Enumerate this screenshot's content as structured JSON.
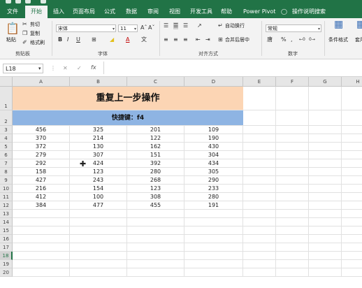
{
  "ribbon_tabs": [
    "文件",
    "开始",
    "插入",
    "页面布局",
    "公式",
    "数据",
    "审阅",
    "视图",
    "开发工具",
    "帮助",
    "Power Pivot"
  ],
  "tell_me": "操作说明搜索",
  "clipboard": {
    "paste": "粘贴",
    "cut": "剪切",
    "copy": "复制",
    "format_painter": "格式刷",
    "label": "剪贴板"
  },
  "font": {
    "name": "宋体",
    "size": "11",
    "label": "字体"
  },
  "alignment": {
    "wrap": "自动换行",
    "merge": "合并后居中",
    "label": "对齐方式"
  },
  "number": {
    "format": "常规",
    "label": "数字"
  },
  "styles": {
    "conditional": "条件格式",
    "table": "套用表格格式"
  },
  "name_box": "L18",
  "fx": "fx",
  "columns": [
    "A",
    "B",
    "C",
    "D",
    "E",
    "F",
    "G",
    "H"
  ],
  "rows": [
    "1",
    "2",
    "3",
    "4",
    "5",
    "6",
    "7",
    "8",
    "9",
    "10",
    "11",
    "12",
    "13",
    "14",
    "15",
    "16",
    "17",
    "18",
    "19",
    "20"
  ],
  "selected_row": "18",
  "sheet": {
    "title": "重复上一步操作",
    "subtitle": "快捷键：f4",
    "data": [
      [
        "456",
        "325",
        "201",
        "109"
      ],
      [
        "370",
        "214",
        "122",
        "190"
      ],
      [
        "372",
        "130",
        "162",
        "430"
      ],
      [
        "279",
        "307",
        "151",
        "304"
      ],
      [
        "292",
        "424",
        "392",
        "434"
      ],
      [
        "158",
        "123",
        "280",
        "305"
      ],
      [
        "427",
        "243",
        "268",
        "290"
      ],
      [
        "216",
        "154",
        "123",
        "233"
      ],
      [
        "412",
        "100",
        "308",
        "280"
      ],
      [
        "384",
        "477",
        "455",
        "191"
      ]
    ]
  }
}
